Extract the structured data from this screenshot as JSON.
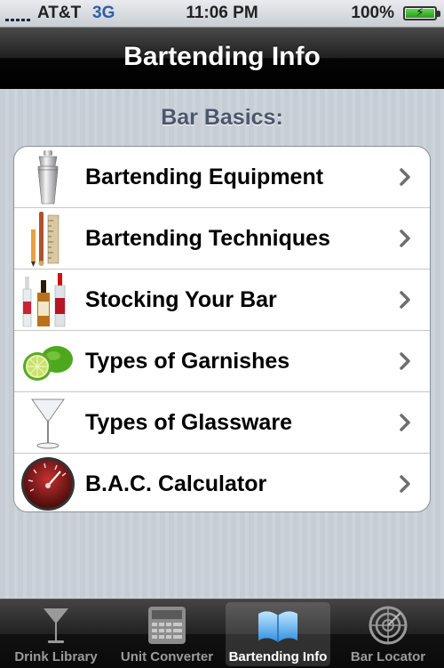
{
  "status": {
    "carrier": "AT&T",
    "network": "3G",
    "time": "11:06 PM",
    "battery": "100%"
  },
  "nav": {
    "title": "Bartending Info"
  },
  "section": {
    "header": "Bar Basics:"
  },
  "rows": [
    {
      "label": "Bartending Equipment",
      "icon": "cocktail-shaker-icon"
    },
    {
      "label": "Bartending Techniques",
      "icon": "bar-tools-icon"
    },
    {
      "label": "Stocking Your Bar",
      "icon": "liquor-bottles-icon"
    },
    {
      "label": "Types of Garnishes",
      "icon": "lime-icon"
    },
    {
      "label": "Types of Glassware",
      "icon": "martini-glass-icon"
    },
    {
      "label": "B.A.C. Calculator",
      "icon": "gauge-icon"
    }
  ],
  "tabs": [
    {
      "label": "Drink Library",
      "icon": "martini-glass-icon",
      "selected": false
    },
    {
      "label": "Unit Converter",
      "icon": "keypad-icon",
      "selected": false
    },
    {
      "label": "Bartending Info",
      "icon": "open-book-icon",
      "selected": true
    },
    {
      "label": "Bar Locator",
      "icon": "radar-icon",
      "selected": false
    }
  ],
  "colors": {
    "section_header": "#4c566c",
    "network": "#2d5fa8",
    "tab_selected_text": "#ffffff",
    "tab_text": "#9b9b9b"
  }
}
